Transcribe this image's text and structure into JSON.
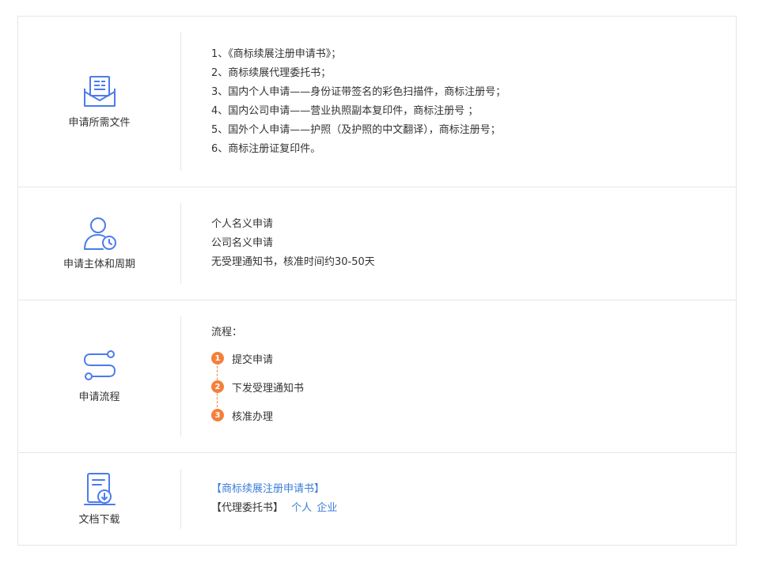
{
  "colors": {
    "icon": "#4b7bec",
    "step": "#f57f3b",
    "link": "#3b7dd8",
    "border": "#e6e6e6"
  },
  "sections": [
    {
      "icon": "document-envelope-icon",
      "label": "申请所需文件",
      "lines": [
        "1、《商标续展注册申请书》；",
        "2、商标续展代理委托书；",
        "3、国内个人申请——身份证带签名的彩色扫描件，商标注册号；",
        "4、国内公司申请——营业执照副本复印件，商标注册号 ；",
        "5、国外个人申请——护照（及护照的中文翻译），商标注册号；",
        "6、商标注册证复印件。"
      ]
    },
    {
      "icon": "user-clock-icon",
      "label": "申请主体和周期",
      "lines": [
        "个人名义申请",
        "公司名义申请",
        "无受理通知书，核准时间约30-50天"
      ]
    },
    {
      "icon": "flow-icon",
      "label": "申请流程",
      "intro": "流程：",
      "steps": [
        {
          "num": "1",
          "text": "提交申请"
        },
        {
          "num": "2",
          "text": "下发受理通知书"
        },
        {
          "num": "3",
          "text": "核准办理"
        }
      ]
    },
    {
      "icon": "document-download-icon",
      "label": "文档下载",
      "download1": "【商标续展注册申请书】",
      "download2_prefix": "【代理委托书】",
      "download2_personal": "个人",
      "download2_company": "企业"
    }
  ]
}
